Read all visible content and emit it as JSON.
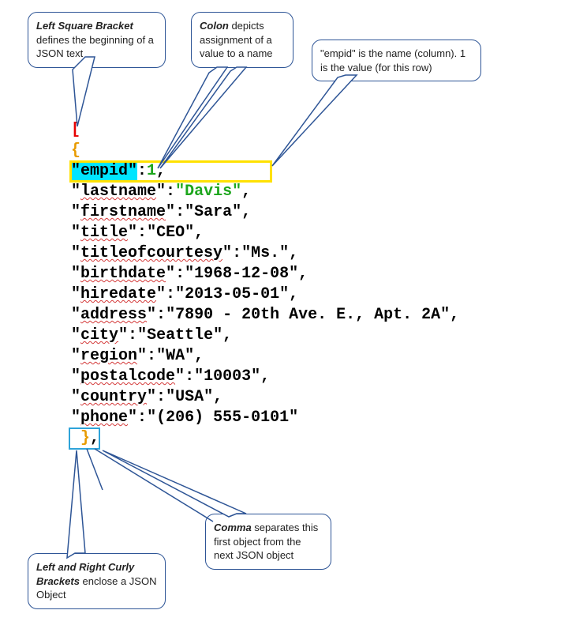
{
  "callouts": {
    "left_bracket": {
      "text_prefix": "Left Square Bracket",
      "text_suffix": " defines the beginning of a JSON text"
    },
    "colon": {
      "text_prefix": "Colon",
      "text_suffix": " depicts assignment of a value to a name"
    },
    "empid": {
      "text": "\"empid\" is the name (column). 1 is the value (for this row)"
    },
    "curly": {
      "text_prefix": "Left and Right Curly Brackets",
      "text_suffix": " enclose a JSON Object"
    },
    "comma": {
      "text_prefix": "Comma",
      "text_suffix": " separates this first object from the next JSON object"
    }
  },
  "json_sample": {
    "open_bracket": "[",
    "open_brace": "{",
    "fields": [
      {
        "key": "empid",
        "value": "1",
        "value_is_number": true,
        "highlight_key": true,
        "value_green": true
      },
      {
        "key": "lastname",
        "value": "\"Davis\"",
        "value_green": true
      },
      {
        "key": "firstname",
        "value": "\"Sara\""
      },
      {
        "key": "title",
        "value": "\"CEO\""
      },
      {
        "key": "titleofcourtesy",
        "value": "\"Ms.\""
      },
      {
        "key": "birthdate",
        "value": "\"1968-12-08\""
      },
      {
        "key": "hiredate",
        "value": "\"2013-05-01\""
      },
      {
        "key": "address",
        "value": "\"7890 - 20th Ave. E., Apt. 2A\""
      },
      {
        "key": "city",
        "value": "\"Seattle\""
      },
      {
        "key": "region",
        "value": "\"WA\""
      },
      {
        "key": "postalcode",
        "value": "\"10003\""
      },
      {
        "key": "country",
        "value": "\"USA\""
      },
      {
        "key": "phone",
        "value": "\"(206) 555-0101\"",
        "last": true
      }
    ],
    "close_brace": "}",
    "trailing_comma": ","
  }
}
